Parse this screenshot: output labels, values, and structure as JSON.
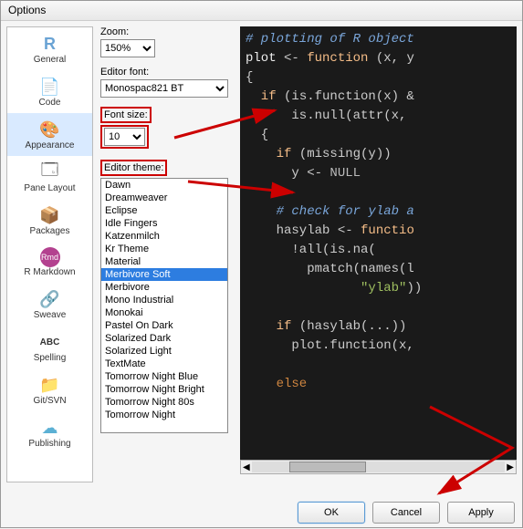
{
  "window": {
    "title": "Options"
  },
  "sidebar": {
    "items": [
      {
        "label": "General",
        "icon": "R"
      },
      {
        "label": "Code",
        "icon": "📄"
      },
      {
        "label": "Appearance",
        "icon": "🎨"
      },
      {
        "label": "Pane Layout",
        "icon": "🗔"
      },
      {
        "label": "Packages",
        "icon": "📦"
      },
      {
        "label": "R Markdown",
        "icon": "Rmd"
      },
      {
        "label": "Sweave",
        "icon": "🔗"
      },
      {
        "label": "Spelling",
        "icon": "ABC"
      },
      {
        "label": "Git/SVN",
        "icon": "📁"
      },
      {
        "label": "Publishing",
        "icon": "☁"
      }
    ],
    "selected": "Appearance"
  },
  "options": {
    "zoom_label": "Zoom:",
    "zoom_value": "150%",
    "font_label": "Editor font:",
    "font_value": "Monospac821 BT",
    "size_label": "Font size:",
    "size_value": "10",
    "theme_label": "Editor theme:",
    "themes": [
      "Dawn",
      "Dreamweaver",
      "Eclipse",
      "Idle Fingers",
      "Katzenmilch",
      "Kr Theme",
      "Material",
      "Merbivore Soft",
      "Merbivore",
      "Mono Industrial",
      "Monokai",
      "Pastel On Dark",
      "Solarized Dark",
      "Solarized Light",
      "TextMate",
      "Tomorrow Night Blue",
      "Tomorrow Night Bright",
      "Tomorrow Night 80s",
      "Tomorrow Night"
    ],
    "theme_selected": "Merbivore Soft"
  },
  "preview_code": {
    "l1a": "# plotting of R object",
    "l2a": "plot",
    "l2b": " <- ",
    "l2c": "function",
    "l2d": " (x, y",
    "l3": "{",
    "l4a": "  if",
    "l4b": " (is.function(x) &",
    "l5": "      is.null(attr(x,",
    "l6": "  {",
    "l7a": "    if",
    "l7b": " (missing(y))",
    "l8a": "      y <- ",
    "l8b": "NULL",
    "l9": " ",
    "l10a": "    # check for ylab a",
    "l11a": "    hasylab <- ",
    "l11b": "functio",
    "l12": "      !all(is.na(",
    "l13": "        pmatch(names(l",
    "l14a": "               ",
    "l14b": "\"ylab\"",
    "l14c": "))",
    "l15": " ",
    "l16a": "    if",
    "l16b": " (hasylab(...))",
    "l17": "      plot.function(x,",
    "l18": " ",
    "l19": "    else"
  },
  "buttons": {
    "ok": "OK",
    "cancel": "Cancel",
    "apply": "Apply"
  }
}
